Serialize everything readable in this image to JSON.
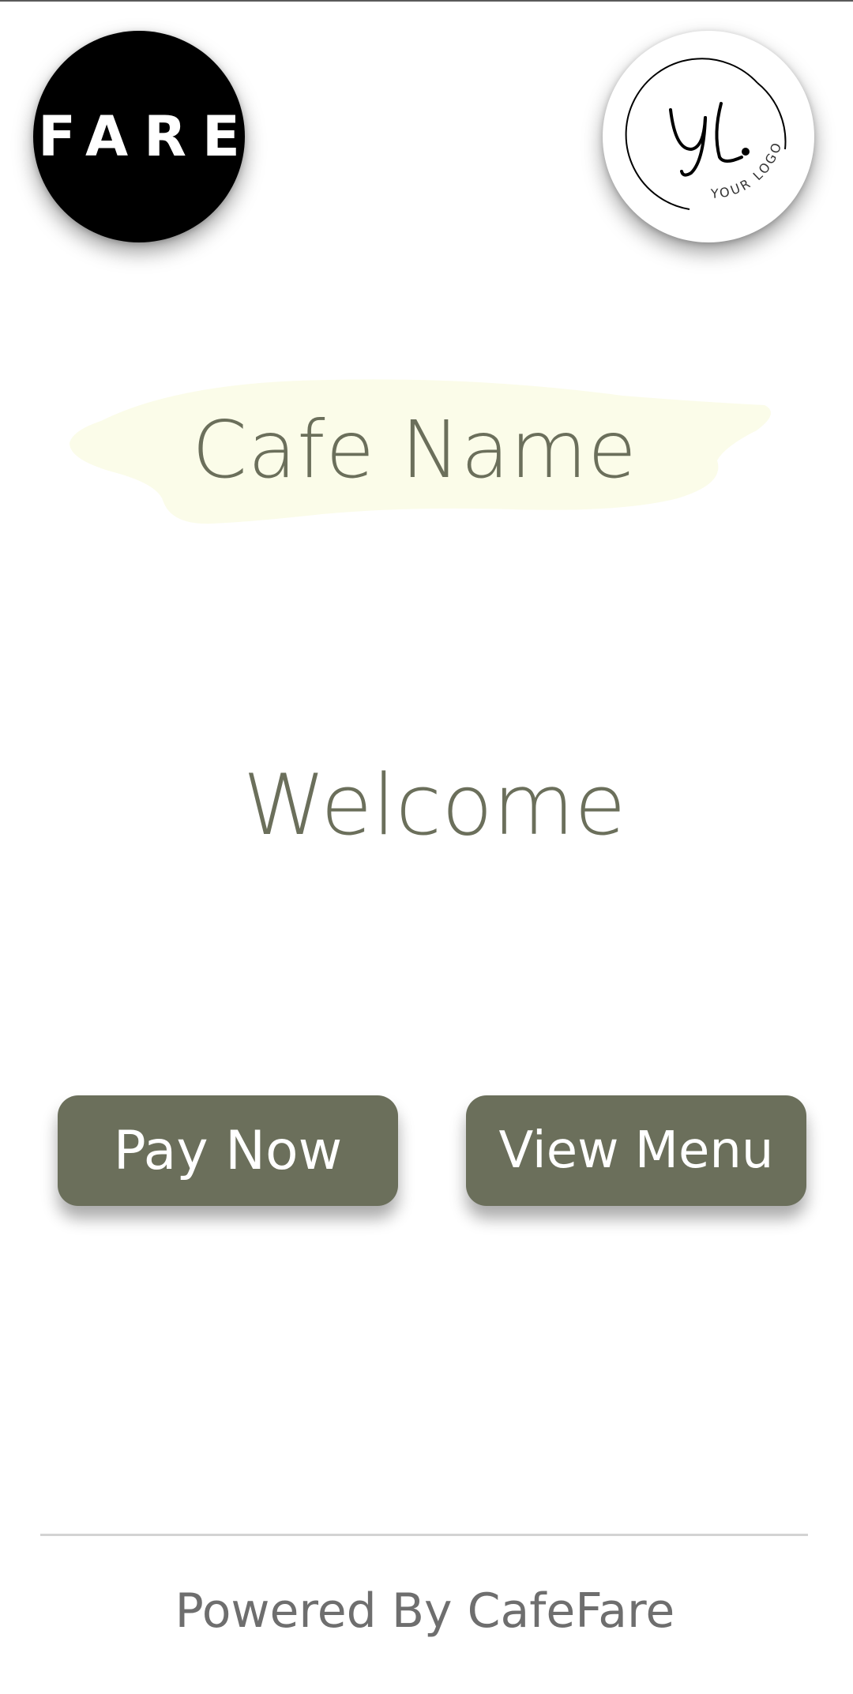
{
  "logos": {
    "platform_logo": {
      "text": "FARE",
      "icon": "fare-logo-icon",
      "background": "#000000",
      "text_color": "#ffffff"
    },
    "cafe_logo": {
      "monogram": "YL.",
      "ring_text": "YOUR LOGO",
      "icon": "your-logo-placeholder-icon",
      "background": "#ffffff"
    }
  },
  "header": {
    "cafe_name": "Cafe Name",
    "highlight_color": "#fbfce9"
  },
  "main": {
    "welcome_text": "Welcome"
  },
  "actions": {
    "pay_now_label": "Pay Now",
    "view_menu_label": "View Menu",
    "button_color": "#6b6f5b",
    "button_text_color": "#ffffff"
  },
  "footer": {
    "powered_by": "Powered By CafeFare"
  },
  "theme": {
    "accent": "#6b6f5b",
    "text_muted": "#6e6e6e"
  }
}
